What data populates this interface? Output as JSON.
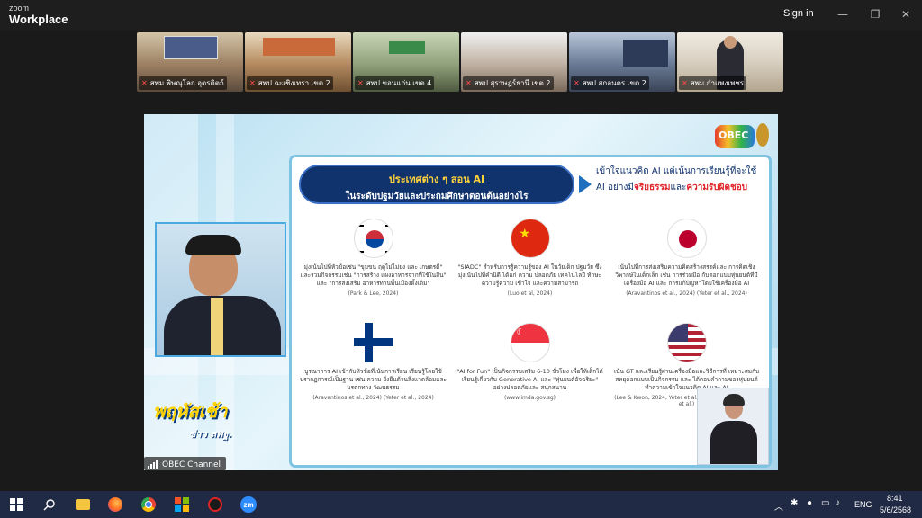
{
  "app": {
    "brand_small": "zoom",
    "brand_big": "Workplace",
    "signin_label": "Sign in"
  },
  "window_controls": {
    "minimize": "—",
    "restore": "❐",
    "close": "✕"
  },
  "thumbnails": [
    {
      "label": "สพม.พิษณุโลก อุตรดิตถ์"
    },
    {
      "label": "สพป.ฉะเชิงเทรา เขต 2"
    },
    {
      "label": "สพป.ขอนแก่น เขต 4"
    },
    {
      "label": "สพป.สุราษฎร์ธานี เขต 2"
    },
    {
      "label": "สพป.สกลนคร เขต 2"
    },
    {
      "label": "สพม.กำแพงเพชร"
    }
  ],
  "slide": {
    "question_line1": "ประเทศต่าง ๆ สอน AI",
    "question_line2": "ในระดับปฐมวัยและประถมศึกษาตอนต้นอย่างไร",
    "key_line1": "เข้าใจแนวคิด AI แต่เน้นการเรียนรู้ที่จะใช้",
    "key_line2_a": "AI อย่างมี",
    "key_line2_b": "จริยธรรม",
    "key_line2_c": "และ",
    "key_line2_d": "ความรับผิดชอบ",
    "countries": [
      {
        "name": "south-korea",
        "text": "มุ่งเน้นไปที่หัวข้อเช่น \"ขุมขน ฤดูไม่ไม่ยง และ เกษตรดี\" และรวมกิจกรรมเช่น \"การสร้าง แผงอาหารจากที่ใช้ในสีน\" และ \"การส่งเสริม อาหารทานพื้นเมืองดั้งเดิม\"",
        "ref": "(Park & Lee, 2024)"
      },
      {
        "name": "china",
        "text": "\"SIADC\" สำหรับการรู้ความรู้ของ AI ในวัยเด็ก ปฐมวัย ซึ่งมุ่งเน้นไปที่คำนิดี ได้แก่ ความ ปลอดภัย เทคโนโลยี ทักษะ ความรู้ความ เข้าใจ และความสามารถ",
        "ref": "(Luo et al, 2024)"
      },
      {
        "name": "japan",
        "text": "เน้นไปที่การส่งเสริมความคิดสร้างสรรค์และ การคิดเชิงวิพากษ์ในเด็กเล็ก เช่น การร่วมมือ กับตอกแบบหุ่นยนต์ที่มีเครื่องมือ AI และ การแก้ปัญหาโดยใช้เครื่องมือ AI",
        "ref": "(Aravantinos et al., 2024) (Yeter et al., 2024)"
      },
      {
        "name": "finland",
        "text": "บูรณาการ AI เข้ากับหัวข้อที่เน้นการเรียน เรียนรู้โดยใช้ปรากฏการณ์เป็นฐาน เช่น ความ ยั่งยืนด้านสิ่งแวดล้อมและมรดกทาง วัฒนธรรม",
        "ref": "(Aravantinos et al., 2024) (Yeter et al., 2024)"
      },
      {
        "name": "singapore",
        "text": "\"AI for Fun\" เป็นกิจกรรมเสริม 6-10 ชั่วโมง เพื่อให้เด็กได้เรียนรู้เกี่ยวกับ Generative AI และ \"หุ่นยนต์อัจฉริยะ\" อย่างปลอดภัยและ สนุกสนาน",
        "ref": "(www.imda.gov.sg)"
      },
      {
        "name": "usa",
        "text": "เน้น GT และเรียนรู้ผ่านเครื่องมือและวิธีการที่ เหมาะสมกับสหยุคอกแบบเป็นกิจกรรม และ ได้ตอบคำถามของหุ่นยนต์ ทำความเข้าใจแนวคิด AI และ AI",
        "ref": "(Lee & Kwon, 2024, Yeter et al., Yim & Su, 2024, Yang et al.)"
      }
    ],
    "show_title": "พฤหัสเช้า",
    "show_subtitle": "ข่าว สพฐ.",
    "obec_logo": "OBEC"
  },
  "channel": {
    "label": "OBEC Channel"
  },
  "taskbar": {
    "lang": "ENG",
    "time": "8:41",
    "date": "5/6/2568",
    "icons": [
      "windows-icon",
      "search-icon",
      "file-explorer-icon",
      "firefox-icon",
      "chrome-icon",
      "app-grid-icon",
      "red-app-icon",
      "zoom-icon"
    ]
  }
}
